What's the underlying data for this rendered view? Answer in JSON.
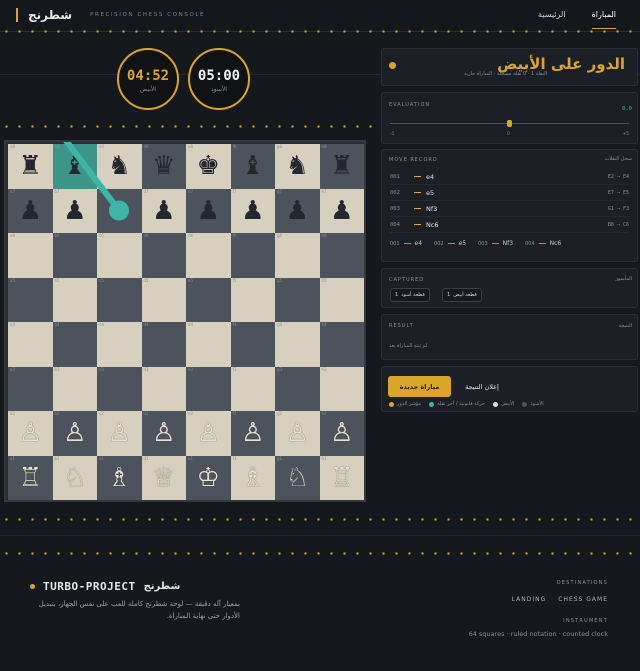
{
  "header": {
    "brand_ar": "شطرنج",
    "brand_en": "PRECISION CHESS CONSOLE",
    "nav": [
      {
        "label": "المباراة",
        "active": true
      },
      {
        "label": "الرئيسية",
        "active": false
      }
    ]
  },
  "clocks": {
    "white": {
      "time": "04:52",
      "label": "الأبيض"
    },
    "black": {
      "time": "05:00",
      "label": "الأسود"
    }
  },
  "board": {
    "ranks": [
      [
        "♜",
        "♝",
        "♞",
        "♛",
        "♚",
        "♝",
        "♞",
        "♜"
      ],
      [
        "♟",
        "♟",
        "",
        "♟",
        "♟",
        "♟",
        "♟",
        "♟"
      ],
      [
        "",
        "",
        "",
        "",
        "",
        "",
        "",
        ""
      ],
      [
        "",
        "",
        "",
        "",
        "",
        "",
        "",
        ""
      ],
      [
        "",
        "",
        "",
        "",
        "",
        "",
        "",
        ""
      ],
      [
        "",
        "",
        "",
        "",
        "",
        "",
        "",
        ""
      ],
      [
        "♙",
        "♙",
        "♙",
        "♙",
        "♙",
        "♙",
        "♙",
        "♙"
      ],
      [
        "♖",
        "♘",
        "♗",
        "♕",
        "♔",
        "♗",
        "♘",
        "♖"
      ]
    ],
    "highlight": "b8",
    "arrow": {
      "from": "b8",
      "to": "c7"
    }
  },
  "turn": {
    "title": "الدور على الأبيض",
    "subtitle": "النقلة 1 · 0 نقلة مسجّلة · المباراة جارية"
  },
  "evaluation": {
    "label": "EVALUATION",
    "value": "0.0",
    "ticks": [
      "-5",
      "0",
      "+5"
    ],
    "level": 0.5
  },
  "moves": {
    "label": "MOVE RECORD",
    "label_ar": "سجل النقلات",
    "rows": [
      {
        "num": "001",
        "san": "e4",
        "squares": "E2 → E4"
      },
      {
        "num": "002",
        "san": "e5",
        "squares": "E7 → E5"
      },
      {
        "num": "003",
        "san": "Nf3",
        "squares": "G1 → F3"
      },
      {
        "num": "004",
        "san": "Nc6",
        "squares": "B8 → C6"
      }
    ]
  },
  "captured": {
    "label": "CAPTURED",
    "label_ar": "المأسور",
    "chips": [
      {
        "label": "قطعة أبيض",
        "count": "1"
      },
      {
        "label": "قطعة أسود",
        "count": "1"
      }
    ]
  },
  "result": {
    "label": "RESULT",
    "label_ar": "النتيجة",
    "text": "لم تنتهِ المباراة بعد"
  },
  "actions": {
    "new_game": "مباراة جديدة",
    "declare": "إعلان النتيجة",
    "legend": [
      {
        "label": "مؤشر الدور",
        "color": "#d9a62b"
      },
      {
        "label": "حركة قانونية / آخر نقلة",
        "color": "#3fb5a8"
      },
      {
        "label": "الأبيض",
        "color": "#e6e0d0"
      },
      {
        "label": "الأسود",
        "color": "#4c535d"
      }
    ]
  },
  "footer": {
    "title_en": "TURBO-PROJECT",
    "title_ar": "شطرنج",
    "desc": "بمعيار آله دقيقة — لوحة شطرنج كاملة للعب على نفس الجهاز، بتبديل الأدوار حتى نهاية المباراة.",
    "destinations_label": "DESTINATIONS",
    "links": [
      "CHESS GAME",
      "LANDING"
    ],
    "instrument_label": "INSTRUMENT",
    "note": "64 squares · ruled notation · counted clock"
  },
  "colors": {
    "accent": "#d9a62b",
    "teal": "#3fb5a8",
    "bg": "#15181d"
  }
}
